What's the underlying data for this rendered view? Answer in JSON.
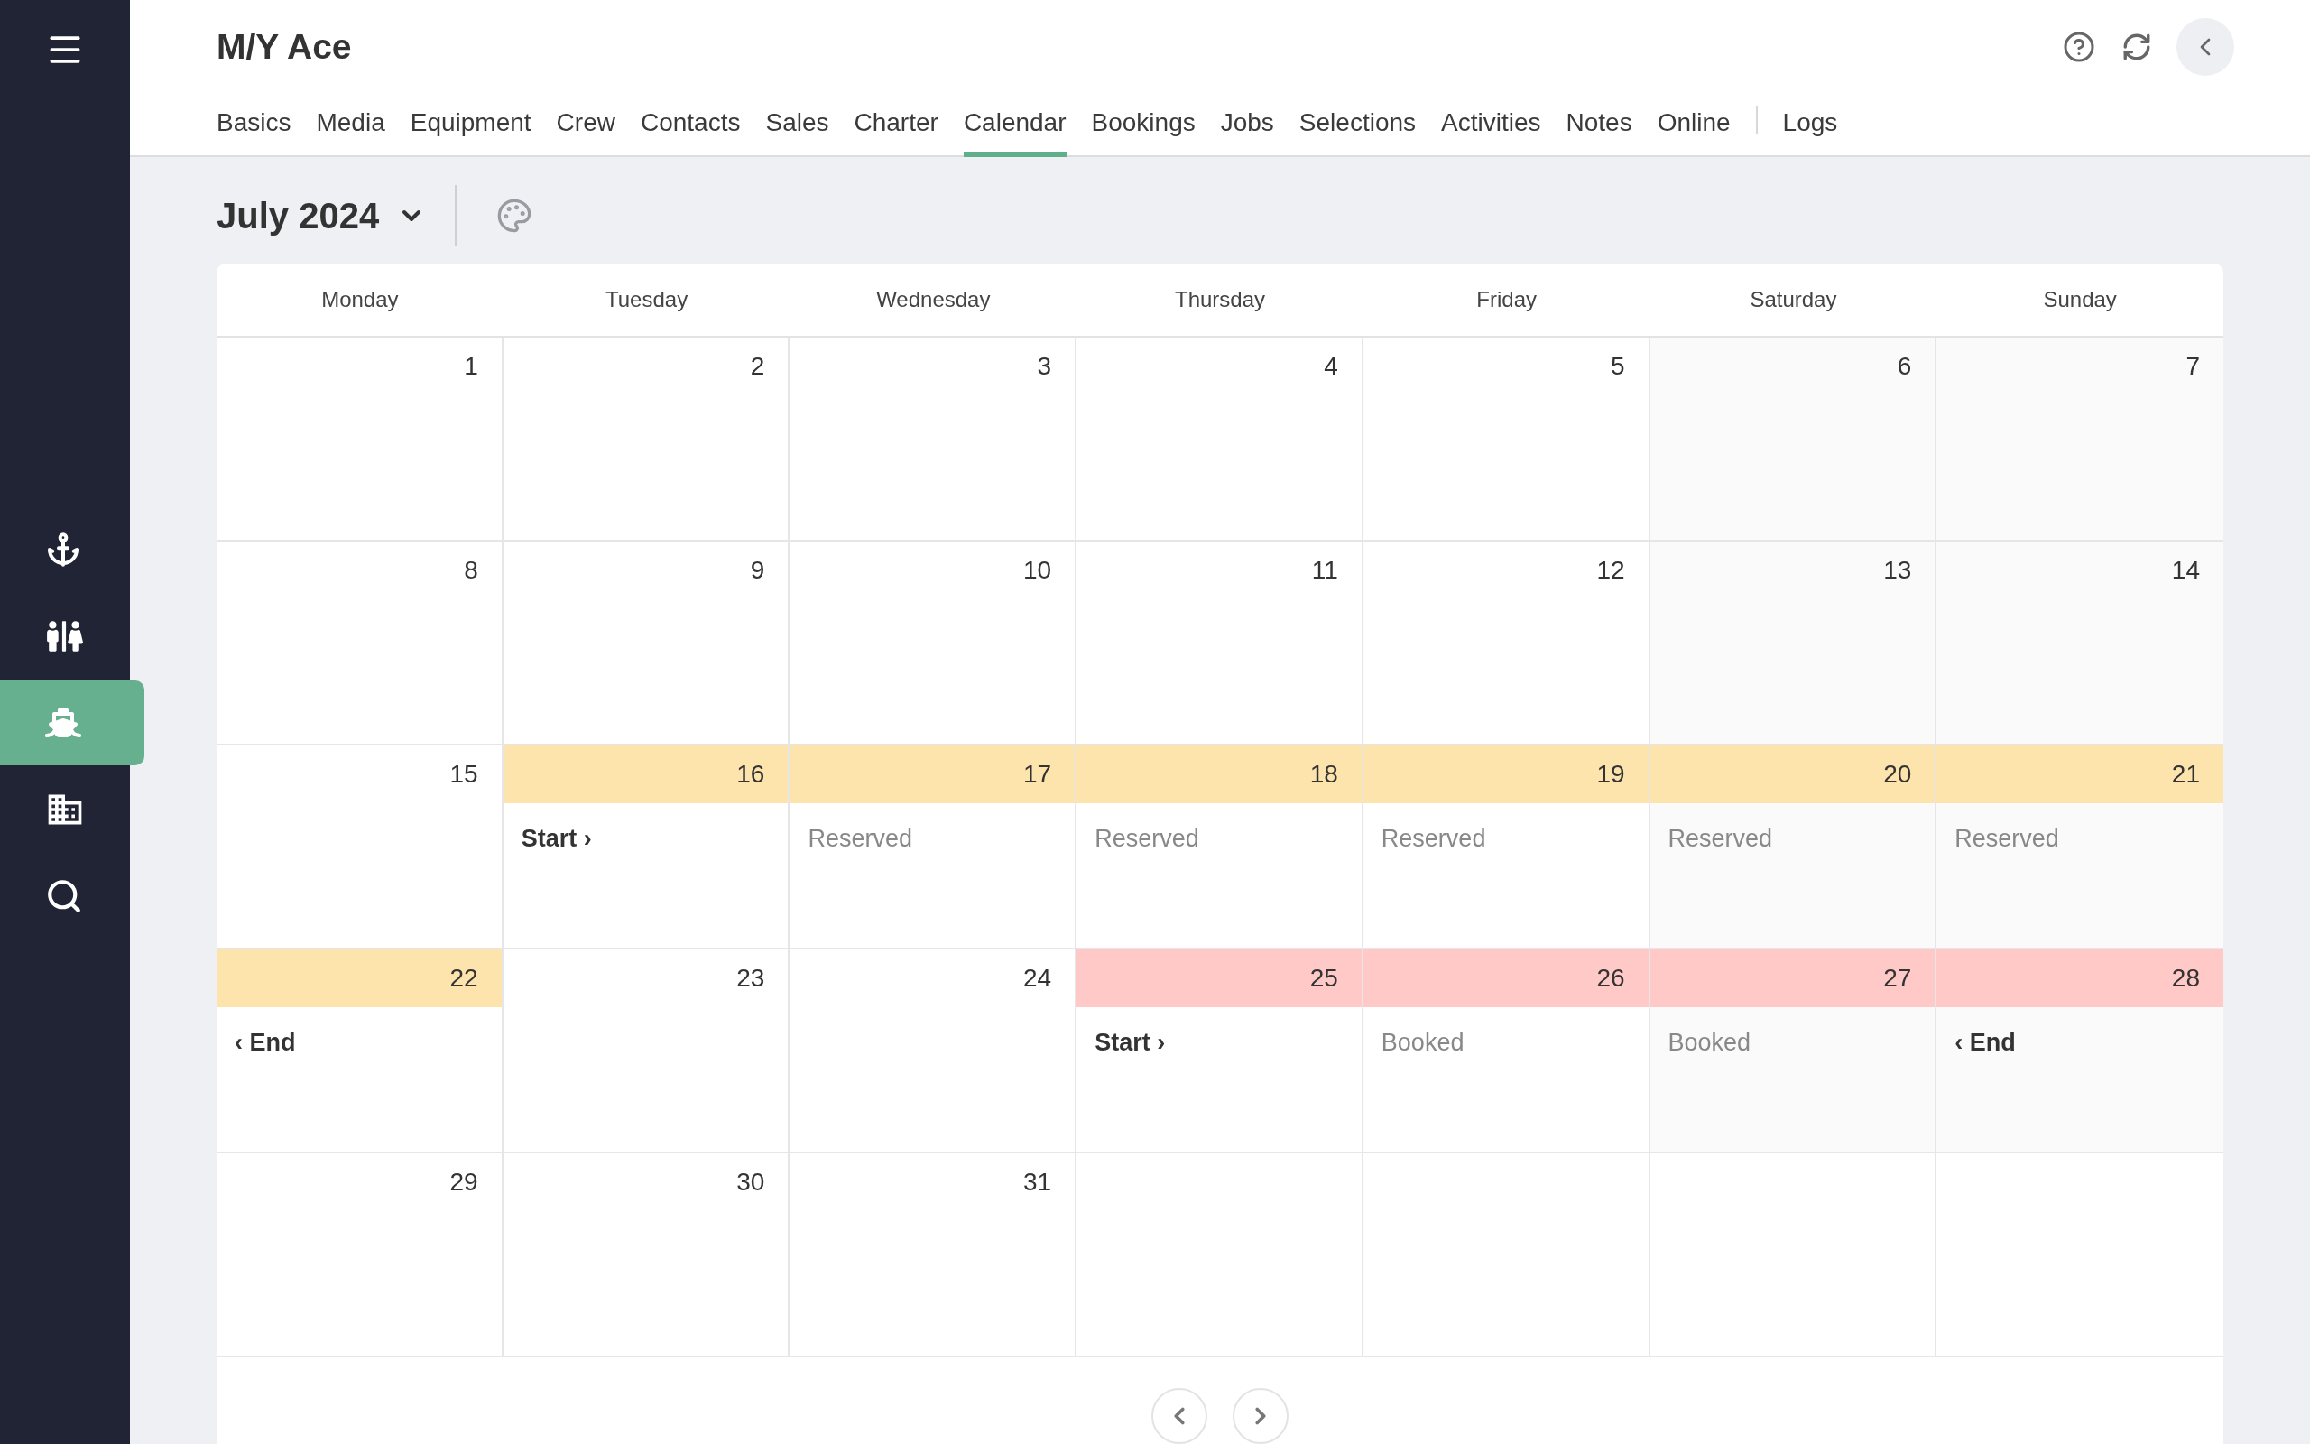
{
  "sidebar": {
    "items": [
      {
        "kind": "anchor",
        "selected": false
      },
      {
        "kind": "people",
        "selected": false
      },
      {
        "kind": "ship",
        "selected": true
      },
      {
        "kind": "building",
        "selected": false
      },
      {
        "kind": "search",
        "selected": false
      }
    ]
  },
  "header": {
    "title": "M/Y Ace"
  },
  "tabs": [
    {
      "label": "Basics",
      "selected": false
    },
    {
      "label": "Media",
      "selected": false
    },
    {
      "label": "Equipment",
      "selected": false
    },
    {
      "label": "Crew",
      "selected": false
    },
    {
      "label": "Contacts",
      "selected": false
    },
    {
      "label": "Sales",
      "selected": false
    },
    {
      "label": "Charter",
      "selected": false
    },
    {
      "label": "Calendar",
      "selected": true
    },
    {
      "label": "Bookings",
      "selected": false
    },
    {
      "label": "Jobs",
      "selected": false
    },
    {
      "label": "Selections",
      "selected": false
    },
    {
      "label": "Activities",
      "selected": false
    },
    {
      "label": "Notes",
      "selected": false
    },
    {
      "label": "Online",
      "selected": false
    },
    {
      "label": "Logs",
      "selected": false,
      "separated": true
    }
  ],
  "calendar": {
    "month": "July 2024",
    "weekdays": [
      "Monday",
      "Tuesday",
      "Wednesday",
      "Thursday",
      "Friday",
      "Saturday",
      "Sunday"
    ],
    "weeks": [
      [
        {
          "kind": "day",
          "day": "1"
        },
        {
          "kind": "day",
          "day": "2"
        },
        {
          "kind": "day",
          "day": "3"
        },
        {
          "kind": "day",
          "day": "4"
        },
        {
          "kind": "day",
          "day": "5"
        },
        {
          "kind": "day",
          "day": "6",
          "weekend": true
        },
        {
          "kind": "day",
          "day": "7",
          "weekend": true
        }
      ],
      [
        {
          "kind": "day",
          "day": "8"
        },
        {
          "kind": "day",
          "day": "9"
        },
        {
          "kind": "day",
          "day": "10"
        },
        {
          "kind": "day",
          "day": "11"
        },
        {
          "kind": "day",
          "day": "12"
        },
        {
          "kind": "day",
          "day": "13",
          "weekend": true
        },
        {
          "kind": "day",
          "day": "14",
          "weekend": true
        }
      ],
      [
        {
          "kind": "day",
          "day": "15"
        },
        {
          "kind": "day",
          "day": "16",
          "color": "#fde4ad",
          "label": {
            "text": "Start ›",
            "kind": "edge"
          }
        },
        {
          "kind": "day",
          "day": "17",
          "color": "#fde4ad",
          "label": {
            "text": "Reserved",
            "kind": "status"
          }
        },
        {
          "kind": "day",
          "day": "18",
          "color": "#fde4ad",
          "label": {
            "text": "Reserved",
            "kind": "status"
          }
        },
        {
          "kind": "day",
          "day": "19",
          "color": "#fde4ad",
          "label": {
            "text": "Reserved",
            "kind": "status"
          }
        },
        {
          "kind": "day",
          "day": "20",
          "weekend": true,
          "color": "#fde4ad",
          "label": {
            "text": "Reserved",
            "kind": "status"
          }
        },
        {
          "kind": "day",
          "day": "21",
          "weekend": true,
          "color": "#fde4ad",
          "label": {
            "text": "Reserved",
            "kind": "status"
          }
        }
      ],
      [
        {
          "kind": "day",
          "day": "22",
          "color": "#fde4ad",
          "label": {
            "text": "‹ End",
            "kind": "edge"
          }
        },
        {
          "kind": "day",
          "day": "23"
        },
        {
          "kind": "day",
          "day": "24"
        },
        {
          "kind": "day",
          "day": "25",
          "color": "#fec9c7",
          "label": {
            "text": "Start ›",
            "kind": "edge"
          }
        },
        {
          "kind": "day",
          "day": "26",
          "color": "#fec9c7",
          "label": {
            "text": "Booked",
            "kind": "status"
          }
        },
        {
          "kind": "day",
          "day": "27",
          "weekend": true,
          "color": "#fec9c7",
          "label": {
            "text": "Booked",
            "kind": "status"
          }
        },
        {
          "kind": "day",
          "day": "28",
          "weekend": true,
          "color": "#fec9c7",
          "label": {
            "text": "‹ End",
            "kind": "edge"
          }
        }
      ],
      [
        {
          "kind": "day",
          "day": "29"
        },
        {
          "kind": "day",
          "day": "30"
        },
        {
          "kind": "day",
          "day": "31"
        },
        {
          "kind": "blank"
        },
        {
          "kind": "blank"
        },
        {
          "kind": "blank"
        },
        {
          "kind": "blank"
        }
      ]
    ]
  }
}
